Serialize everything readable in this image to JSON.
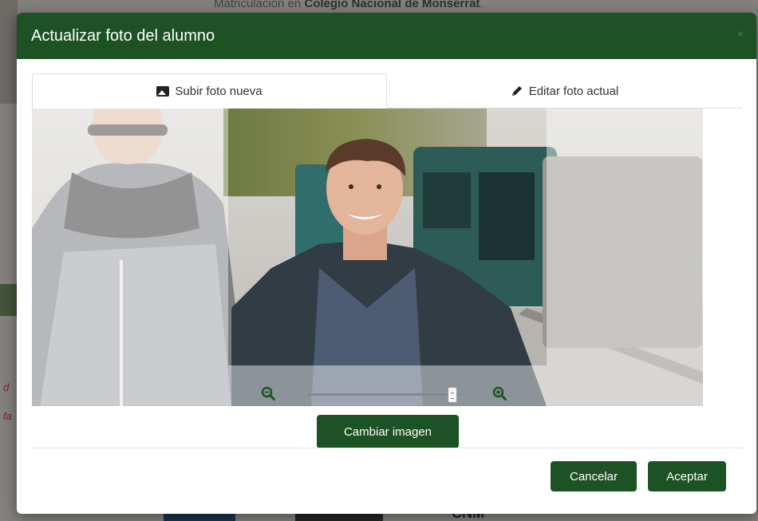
{
  "background": {
    "title_prefix": "Matriculación en",
    "title_bold": "Colegio Nacional de Monserrat",
    "title_suffix": ".",
    "side_text_1": "d",
    "side_text_2": "fa",
    "brand": "CNM"
  },
  "modal": {
    "title": "Actualizar foto del alumno",
    "close_label": "×",
    "tabs": [
      {
        "label": "Subir foto nueva",
        "icon": "image-icon"
      },
      {
        "label": "Editar foto actual",
        "icon": "pencil-icon"
      }
    ],
    "zoom": {
      "value": 0.95
    },
    "change_button": "Cambiar imagen",
    "cancel_button": "Cancelar",
    "accept_button": "Aceptar",
    "colors": {
      "primary": "#1d5224"
    }
  }
}
